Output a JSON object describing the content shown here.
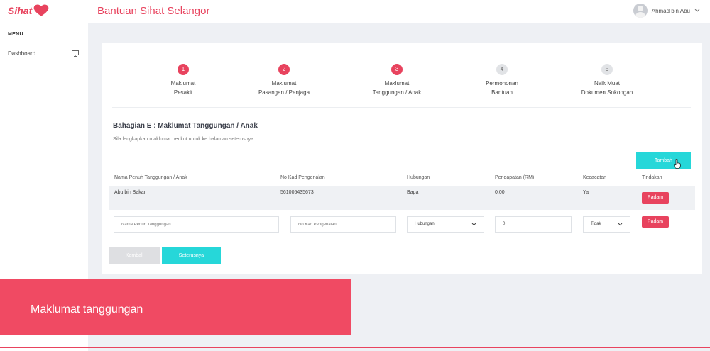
{
  "header": {
    "logo_text": "Sihat",
    "title": "Bantuan Sihat Selangor",
    "user_name": "Ahmad bin Abu"
  },
  "sidebar": {
    "menu_label": "MENU",
    "items": [
      {
        "label": "Dashboard",
        "icon": "monitor-icon"
      }
    ]
  },
  "steps": [
    {
      "num": "1",
      "line1": "Maklumat",
      "line2": "Pesakit",
      "state": "done"
    },
    {
      "num": "2",
      "line1": "Maklumat",
      "line2": "Pasangan / Penjaga",
      "state": "done"
    },
    {
      "num": "3",
      "line1": "Maklumat",
      "line2": "Tanggungan / Anak",
      "state": "active"
    },
    {
      "num": "4",
      "line1": "Permohonan",
      "line2": "Bantuan",
      "state": "pending"
    },
    {
      "num": "5",
      "line1": "Naik Muat",
      "line2": "Dokumen Sokongan",
      "state": "pending"
    }
  ],
  "section": {
    "title": "Bahagian E : Maklumat Tanggungan / Anak",
    "description": "Sila lengkapkan maklumat berikut untuk ke halaman seterusnya."
  },
  "buttons": {
    "add": "Tambah",
    "delete": "Padam",
    "back": "Kembali",
    "next": "Seterusnya"
  },
  "table": {
    "headers": [
      "Nama Penuh Tanggungan / Anak",
      "No Kad Pengenalan",
      "Hubungan",
      "Pendapatan (RM)",
      "Kecacatan",
      "Tindakan"
    ],
    "rows": [
      [
        "Abu bin Bakar",
        "561005435673",
        "Bapa",
        "0.00",
        "Ya"
      ]
    ]
  },
  "form": {
    "name_placeholder": "Nama Penuh Tanggungan",
    "ic_placeholder": "No Kad Pengenalan",
    "relationship_value": "Hubungan",
    "income_value": "0",
    "disability_value": "Tidak"
  },
  "caption": "Maklumat tanggungan",
  "colors": {
    "brand": "#e8435e",
    "accent": "#26d7d9"
  }
}
